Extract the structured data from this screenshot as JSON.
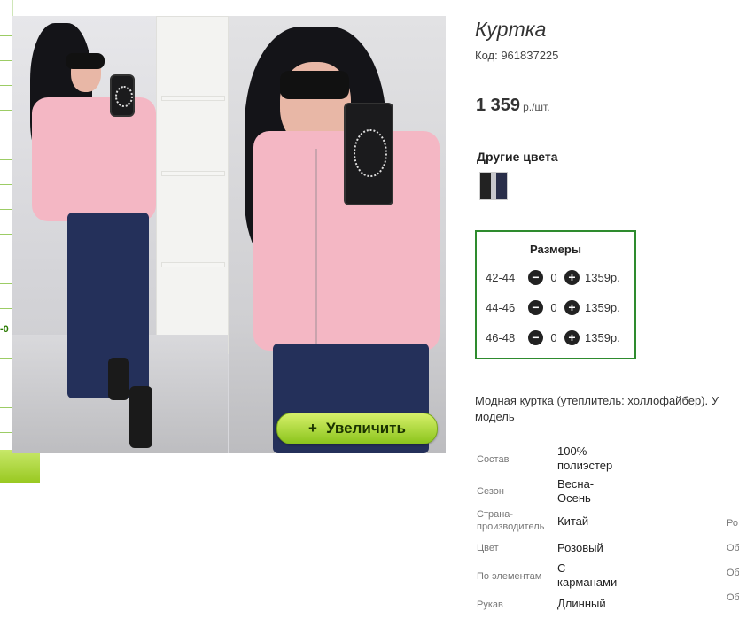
{
  "edge": {
    "label": "-0"
  },
  "gallery": {
    "zoom_icon": "plus-icon",
    "zoom_label": "Увеличить"
  },
  "product": {
    "title": "Куртка",
    "code": "Код: 961837225",
    "price": "1 359",
    "price_unit": "р./шт.",
    "other_colors_label": "Другие цвета"
  },
  "sizes": {
    "title": "Размеры",
    "rows": [
      {
        "size": "42-44",
        "qty": "0",
        "price": "1359р."
      },
      {
        "size": "44-46",
        "qty": "0",
        "price": "1359р."
      },
      {
        "size": "46-48",
        "qty": "0",
        "price": "1359р."
      }
    ],
    "minus_icon": "minus-circle-icon",
    "plus_icon": "plus-circle-icon"
  },
  "description": {
    "line1": "Модная куртка (утеплитель: холлофайбер). У",
    "line2": "модель"
  },
  "properties": [
    {
      "key": "Состав",
      "value": "100% полиэстер"
    },
    {
      "key": "Сезон",
      "value": "Весна-Осень"
    },
    {
      "key": "Страна-производитель",
      "value": "Китай"
    },
    {
      "key": "Цвет",
      "value": "Розовый"
    },
    {
      "key": "По элементам",
      "value": "С карманами"
    },
    {
      "key": "Рукав",
      "value": "Длинный"
    }
  ],
  "right_cut": [
    "Ро",
    "Об",
    "Об",
    "Об"
  ]
}
